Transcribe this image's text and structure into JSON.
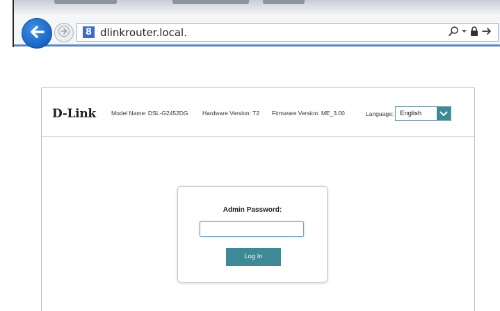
{
  "browser": {
    "url": "dlinkrouter.local.",
    "favicon_glyph": "8",
    "icons": [
      "back-arrow-icon",
      "forward-arrow-icon",
      "search-icon",
      "dropdown-icon",
      "lock-icon",
      "go-arrow-icon"
    ]
  },
  "router": {
    "logo": "D-Link",
    "model_name": "Model Name: DSL-G2452DG",
    "hardware_version": "Hardware Version: T2",
    "firmware_version": "Firmware Version: ME_3.00",
    "language_label": "Language:",
    "language_value": "English"
  },
  "login": {
    "title": "Admin Password:",
    "password_value": "",
    "button_label": "Log In"
  },
  "colors": {
    "accent": "#3d8a96",
    "back_button": "#1a65c4",
    "address_border": "#9fb3cf"
  }
}
